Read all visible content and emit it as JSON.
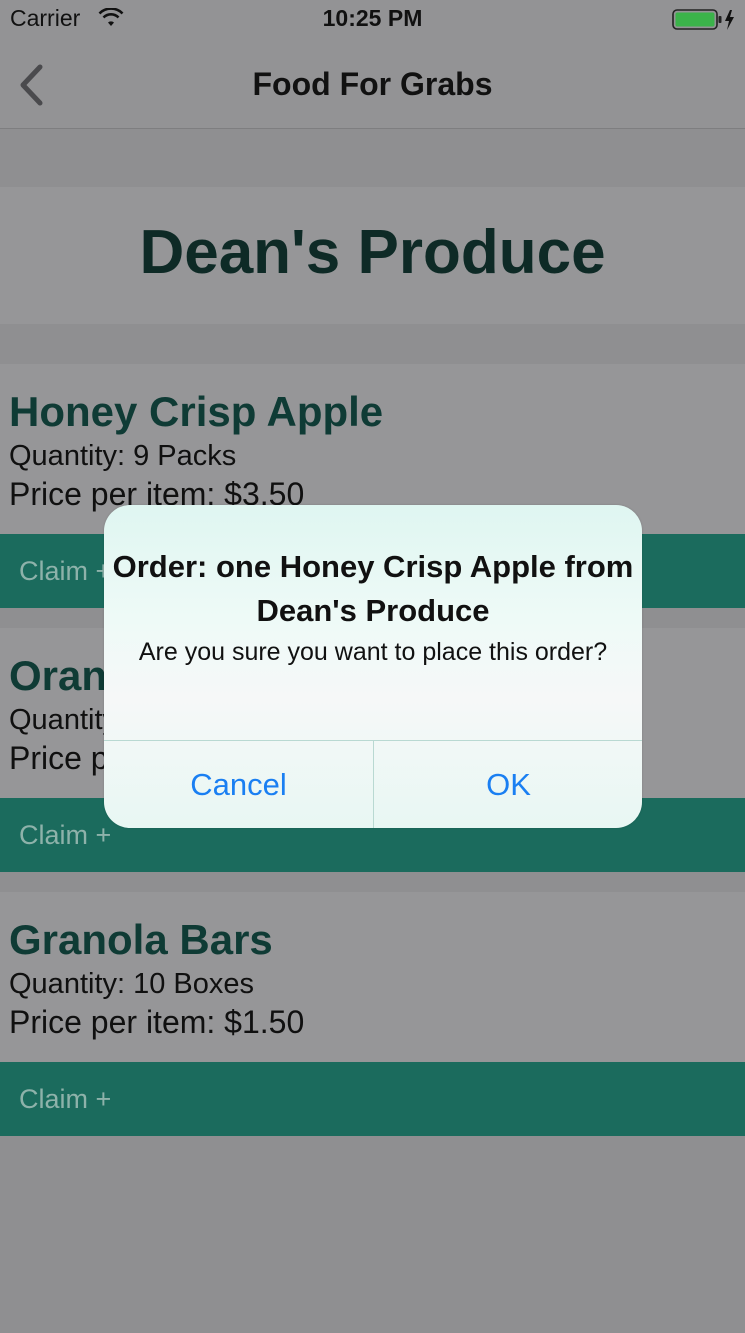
{
  "status_bar": {
    "carrier": "Carrier",
    "time": "10:25 PM",
    "icons": [
      "wifi-icon",
      "battery-icon",
      "charging-bolt-icon"
    ]
  },
  "nav": {
    "title": "Food For Grabs",
    "back_icon": "chevron-left-icon"
  },
  "store": {
    "name": "Dean's Produce"
  },
  "products": [
    {
      "name": "Honey Crisp Apple",
      "quantity": "Quantity: 9 Packs",
      "price": "Price per item: $3.50",
      "claim_label": "Claim +"
    },
    {
      "name": "Oranges",
      "quantity": "Quantity:",
      "price": "Price per item:",
      "claim_label": "Claim +"
    },
    {
      "name": "Granola Bars",
      "quantity": "Quantity: 10 Boxes",
      "price": "Price per item: $1.50",
      "claim_label": "Claim +"
    }
  ],
  "alert": {
    "title": "Order: one Honey Crisp Apple from Dean's Produce",
    "message": "Are you sure you want to place this order?",
    "cancel_label": "Cancel",
    "ok_label": "OK"
  },
  "colors": {
    "accent": "#1a7ff2",
    "claim_bar": "#1b6b5d",
    "product_name": "#0f3b35",
    "store_name": "#0e2a26"
  }
}
